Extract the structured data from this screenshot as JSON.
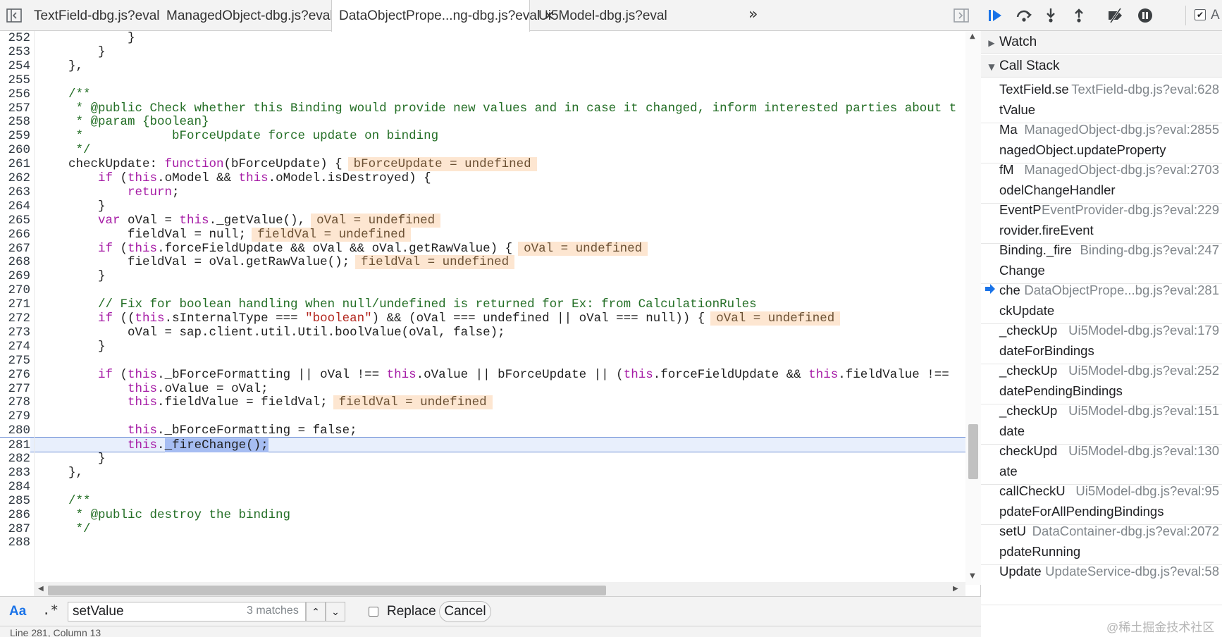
{
  "tabs": [
    {
      "label": "TextField-dbg.js?eval",
      "active": false
    },
    {
      "label": "ManagedObject-dbg.js?eval",
      "active": false
    },
    {
      "label": "DataObjectPrope...ng-dbg.js?eval",
      "active": true
    },
    {
      "label": "Ui5Model-dbg.js?eval",
      "active": false
    }
  ],
  "code_lines": [
    {
      "n": "252",
      "segs": [
        [
          "            }",
          ""
        ]
      ]
    },
    {
      "n": "253",
      "segs": [
        [
          "        }",
          ""
        ]
      ]
    },
    {
      "n": "254",
      "segs": [
        [
          "    },",
          ""
        ]
      ]
    },
    {
      "n": "255",
      "segs": [
        [
          "",
          ""
        ]
      ]
    },
    {
      "n": "256",
      "segs": [
        [
          "    /**",
          "cm"
        ]
      ]
    },
    {
      "n": "257",
      "segs": [
        [
          "     * @public Check whether this Binding would provide new values and in case it changed, inform interested parties about t",
          "cm"
        ]
      ]
    },
    {
      "n": "258",
      "segs": [
        [
          "     * @param {boolean}",
          "cm"
        ]
      ]
    },
    {
      "n": "259",
      "segs": [
        [
          "     *            bForceUpdate force update on binding",
          "cm"
        ]
      ]
    },
    {
      "n": "260",
      "segs": [
        [
          "     */",
          "cm"
        ]
      ]
    },
    {
      "n": "261",
      "segs": [
        [
          "    checkUpdate: ",
          ""
        ],
        [
          "function",
          "kw"
        ],
        [
          "(bForceUpdate) {",
          ""
        ]
      ],
      "val": "bForceUpdate = undefined"
    },
    {
      "n": "262",
      "segs": [
        [
          "        ",
          ""
        ],
        [
          "if",
          "kw"
        ],
        [
          " (",
          ""
        ],
        [
          "this",
          "kw"
        ],
        [
          ".oModel && ",
          ""
        ],
        [
          "this",
          "kw"
        ],
        [
          ".oModel.isDestroyed) {",
          ""
        ]
      ]
    },
    {
      "n": "263",
      "segs": [
        [
          "            ",
          ""
        ],
        [
          "return",
          "kw"
        ],
        [
          ";",
          ""
        ]
      ]
    },
    {
      "n": "264",
      "segs": [
        [
          "        }",
          ""
        ]
      ]
    },
    {
      "n": "265",
      "segs": [
        [
          "        ",
          ""
        ],
        [
          "var",
          "kw"
        ],
        [
          " oVal = ",
          ""
        ],
        [
          "this",
          "kw"
        ],
        [
          "._getValue(),",
          ""
        ]
      ],
      "val": "oVal = undefined"
    },
    {
      "n": "266",
      "segs": [
        [
          "            fieldVal = null;",
          ""
        ]
      ],
      "val": "fieldVal = undefined"
    },
    {
      "n": "267",
      "segs": [
        [
          "        ",
          ""
        ],
        [
          "if",
          "kw"
        ],
        [
          " (",
          ""
        ],
        [
          "this",
          "kw"
        ],
        [
          ".forceFieldUpdate && oVal && oVal.getRawValue) {",
          ""
        ]
      ],
      "val": "oVal = undefined"
    },
    {
      "n": "268",
      "segs": [
        [
          "            fieldVal = oVal.getRawValue();",
          ""
        ]
      ],
      "val": "fieldVal = undefined"
    },
    {
      "n": "269",
      "segs": [
        [
          "        }",
          ""
        ]
      ]
    },
    {
      "n": "270",
      "segs": [
        [
          "",
          ""
        ]
      ]
    },
    {
      "n": "271",
      "segs": [
        [
          "        // Fix for boolean handling when null/undefined is returned for Ex: from CalculationRules",
          "cm"
        ]
      ]
    },
    {
      "n": "272",
      "segs": [
        [
          "        ",
          ""
        ],
        [
          "if",
          "kw"
        ],
        [
          " ((",
          ""
        ],
        [
          "this",
          "kw"
        ],
        [
          ".sInternalType === ",
          ""
        ],
        [
          "\"boolean\"",
          "st"
        ],
        [
          ") && (oVal === undefined || oVal === null)) {",
          ""
        ]
      ],
      "val": "oVal = undefined"
    },
    {
      "n": "273",
      "segs": [
        [
          "            oVal = sap.client.util.Util.boolValue(oVal, false);",
          ""
        ]
      ]
    },
    {
      "n": "274",
      "segs": [
        [
          "        }",
          ""
        ]
      ]
    },
    {
      "n": "275",
      "segs": [
        [
          "",
          ""
        ]
      ]
    },
    {
      "n": "276",
      "segs": [
        [
          "        ",
          ""
        ],
        [
          "if",
          "kw"
        ],
        [
          " (",
          ""
        ],
        [
          "this",
          "kw"
        ],
        [
          "._bForceFormatting || oVal !== ",
          ""
        ],
        [
          "this",
          "kw"
        ],
        [
          ".oValue || bForceUpdate || (",
          ""
        ],
        [
          "this",
          "kw"
        ],
        [
          ".forceFieldUpdate && ",
          ""
        ],
        [
          "this",
          "kw"
        ],
        [
          ".fieldValue !==",
          ""
        ]
      ]
    },
    {
      "n": "277",
      "segs": [
        [
          "            ",
          ""
        ],
        [
          "this",
          "kw"
        ],
        [
          ".oValue = oVal;",
          ""
        ]
      ]
    },
    {
      "n": "278",
      "segs": [
        [
          "            ",
          ""
        ],
        [
          "this",
          "kw"
        ],
        [
          ".fieldValue = fieldVal;",
          ""
        ]
      ],
      "val": "fieldVal = undefined"
    },
    {
      "n": "279",
      "segs": [
        [
          "",
          ""
        ]
      ]
    },
    {
      "n": "280",
      "segs": [
        [
          "            ",
          ""
        ],
        [
          "this",
          "kw"
        ],
        [
          "._bForceFormatting = false;",
          ""
        ]
      ]
    },
    {
      "n": "281",
      "segs": [
        [
          "            ",
          ""
        ],
        [
          "this",
          "kw"
        ],
        [
          ".",
          ""
        ],
        [
          "_fireChange();",
          "hl-sel"
        ]
      ],
      "current": true
    },
    {
      "n": "282",
      "segs": [
        [
          "        }",
          ""
        ]
      ]
    },
    {
      "n": "283",
      "segs": [
        [
          "    },",
          ""
        ]
      ]
    },
    {
      "n": "284",
      "segs": [
        [
          "",
          ""
        ]
      ]
    },
    {
      "n": "285",
      "segs": [
        [
          "    /**",
          "cm"
        ]
      ]
    },
    {
      "n": "286",
      "segs": [
        [
          "     * @public destroy the binding",
          "cm"
        ]
      ]
    },
    {
      "n": "287",
      "segs": [
        [
          "     */",
          "cm"
        ]
      ]
    },
    {
      "n": "288",
      "segs": [
        [
          "",
          ""
        ]
      ]
    }
  ],
  "search": {
    "match_case_label": "Aa",
    "regex_label": ".*",
    "query": "setValue",
    "match_count": "3 matches",
    "prev_label": "⌃",
    "next_label": "⌄",
    "replace_label": "Replace",
    "cancel_label": "Cancel"
  },
  "status_text": "Line 281, Column 13",
  "debugger": {
    "deactivate_label": "A",
    "watch_label": "Watch",
    "callstack_label": "Call Stack"
  },
  "call_stack": [
    {
      "fn1": "TextField.se",
      "fn2": "tValue",
      "loc": "TextField-dbg.js?eval:628",
      "current": false
    },
    {
      "fn1": "Ma",
      "fn2": "nagedObject.updateProperty",
      "loc": "ManagedObject-dbg.js?eval:2855",
      "current": false
    },
    {
      "fn1": "fM",
      "fn2": "odelChangeHandler",
      "loc": "ManagedObject-dbg.js?eval:2703",
      "current": false
    },
    {
      "fn1": "EventP",
      "fn2": "rovider.fireEvent",
      "loc": "EventProvider-dbg.js?eval:229",
      "current": false
    },
    {
      "fn1": "Binding._fire",
      "fn2": "Change",
      "loc": "Binding-dbg.js?eval:247",
      "current": false
    },
    {
      "fn1": "che",
      "fn2": "ckUpdate",
      "loc": "DataObjectPrope...bg.js?eval:281",
      "current": true
    },
    {
      "fn1": "_checkUp",
      "fn2": "dateForBindings",
      "loc": "Ui5Model-dbg.js?eval:179",
      "current": false
    },
    {
      "fn1": "_checkUp",
      "fn2": "datePendingBindings",
      "loc": "Ui5Model-dbg.js?eval:252",
      "current": false
    },
    {
      "fn1": "_checkUp",
      "fn2": "date",
      "loc": "Ui5Model-dbg.js?eval:151",
      "current": false
    },
    {
      "fn1": "checkUpd",
      "fn2": "ate",
      "loc": "Ui5Model-dbg.js?eval:130",
      "current": false
    },
    {
      "fn1": "callCheckU",
      "fn2": "pdateForAllPendingBindings",
      "loc": "Ui5Model-dbg.js?eval:95",
      "current": false
    },
    {
      "fn1": "setU",
      "fn2": "pdateRunning",
      "loc": "DataContainer-dbg.js?eval:2072",
      "current": false
    },
    {
      "fn1": "Update",
      "fn2": "",
      "loc": "UpdateService-dbg.js?eval:58",
      "current": false
    }
  ],
  "watermark": "@稀土掘金技术社区",
  "colors": {
    "accent": "#1a73e8",
    "inline_value_bg": "#fde6d1",
    "current_line_bg": "#e8effc",
    "keyword": "#a61ca6",
    "comment": "#236e25",
    "string": "#b3261e"
  }
}
